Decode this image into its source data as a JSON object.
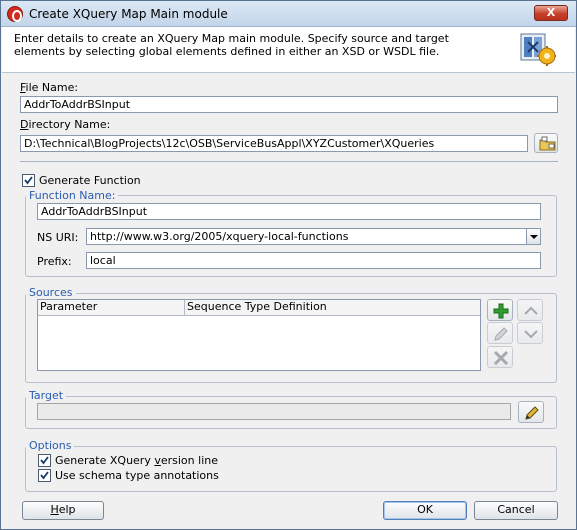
{
  "window": {
    "title": "Create XQuery Map Main module",
    "close_symbol": "X"
  },
  "header": {
    "description": "Enter details to create an XQuery Map main module. Specify source and target elements by selecting global elements defined in either an XSD or WSDL file.",
    "icon": "xquery-wizard-icon"
  },
  "file_name": {
    "label_mnemonic": "F",
    "label_rest": "ile Name:",
    "value": "AddrToAddrBSInput"
  },
  "directory_name": {
    "label_mnemonic": "D",
    "label_rest": "irectory Name:",
    "value": "D:\\Technical\\BlogProjects\\12c\\OSB\\ServiceBusAppl\\XYZCustomer\\XQueries",
    "browse_icon": "browse-folder-icon"
  },
  "generate_function": {
    "label": "Generate Function",
    "checked": true,
    "function_name_label": "Function Name:",
    "function_name_value": "AddrToAddrBSInput",
    "ns_uri_label": "NS URI:",
    "ns_uri_value": "http://www.w3.org/2005/xquery-local-functions",
    "prefix_label": "Prefix:",
    "prefix_value": "local"
  },
  "sources": {
    "legend": "Sources",
    "columns": [
      "Parameter",
      "Sequence Type Definition"
    ],
    "rows": []
  },
  "target": {
    "legend": "Target",
    "value": ""
  },
  "options": {
    "legend": "Options",
    "generate_version_pre": "Generate XQuery ",
    "generate_version_mnemonic": "v",
    "generate_version_post": "ersion line",
    "generate_version_checked": true,
    "schema_annotations_label": "Use schema type annotations",
    "schema_annotations_checked": true
  },
  "buttons": {
    "help": "Help",
    "help_mnemonic": "H",
    "help_rest": "elp",
    "ok": "OK",
    "cancel": "Cancel"
  },
  "colors": {
    "accent_legend": "#2a5db0",
    "add_green": "#2e9e2e",
    "remove_gray": "#6a6f78"
  }
}
